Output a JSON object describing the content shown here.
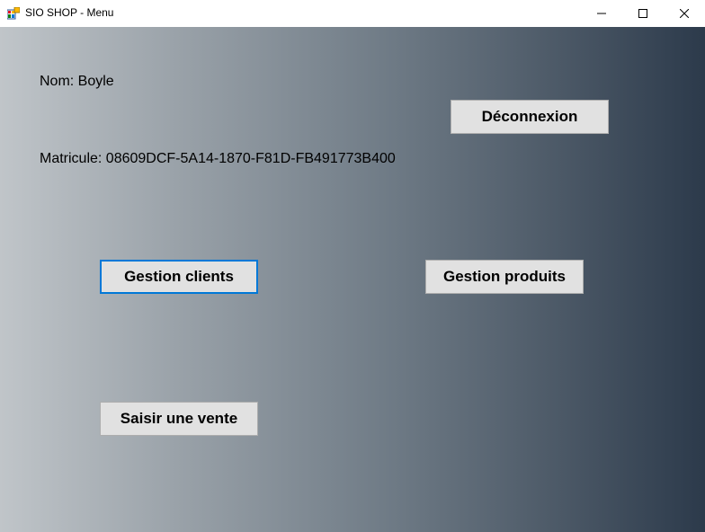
{
  "window": {
    "title": "SIO SHOP - Menu",
    "icon": "app-window-icon",
    "controls": {
      "minimize_icon": "minimize-icon",
      "maximize_icon": "maximize-icon",
      "close_icon": "close-icon"
    }
  },
  "user": {
    "name_text": "Nom: Boyle",
    "matricule_text": "Matricule: 08609DCF-5A14-1870-F81D-FB491773B400"
  },
  "buttons": {
    "logout": "Déconnexion",
    "clients": "Gestion clients",
    "products": "Gestion produits",
    "sale": "Saisir une vente"
  },
  "colors": {
    "gradient_left": "#c0c5c9",
    "gradient_right": "#2c3a4b",
    "button_face": "#e1e1e1",
    "focus_border": "#0078d7"
  }
}
